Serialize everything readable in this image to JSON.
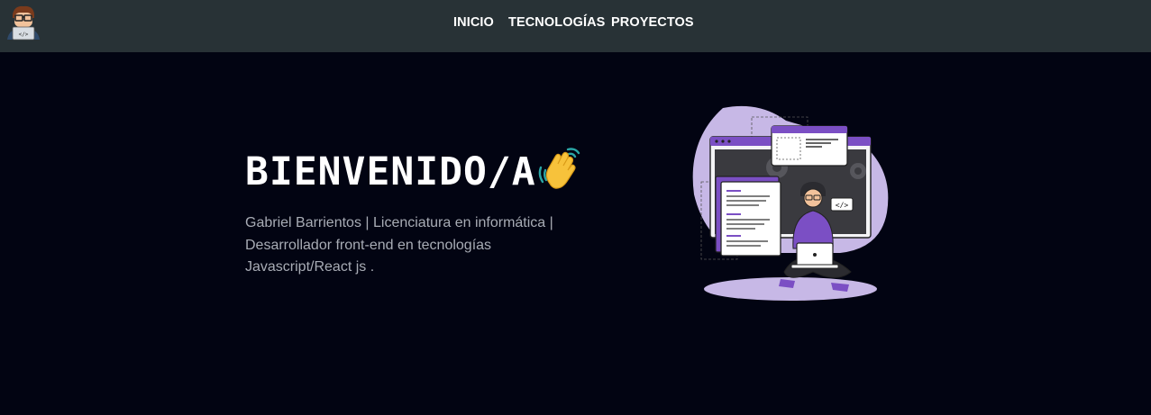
{
  "nav": {
    "logo_icon": "developer-avatar-icon",
    "links": [
      "INICIO",
      "TECNOLOGÍAS",
      "PROYECTOS"
    ]
  },
  "hero": {
    "title": "BIENVENIDO/A",
    "wave_icon": "waving-hand-icon",
    "description": "Gabriel Barrientos | Licenciatura en informática | Desarrollador front-end en tecnologías Javascript/React js .",
    "illustration_icon": "developer-laptop-illustration"
  },
  "colors": {
    "navbar": "#283236",
    "background": "#020412",
    "accent": "#7b4fc4",
    "lavender": "#c7b8e6"
  }
}
